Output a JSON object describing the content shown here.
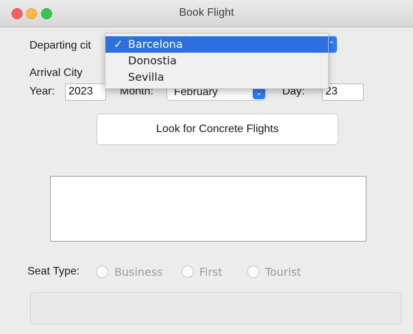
{
  "window": {
    "title": "Book Flight"
  },
  "form": {
    "departing_label": "Departing cit",
    "arrival_label": "Arrival City",
    "year_label": "Year:",
    "year_value": "2023",
    "month_label": "Month:",
    "month_value": "February",
    "day_label": "Day:",
    "day_value": "23",
    "search_button": "Look for Concrete Flights",
    "seat_type_label": "Seat Type:",
    "seat_options": [
      "Business",
      "First",
      "Tourist"
    ]
  },
  "dropdown": {
    "check": "✓",
    "options": [
      "Barcelona",
      "Donostia",
      "Sevilla"
    ],
    "selected_index": 0
  },
  "colors": {
    "accent": "#2b7cf6",
    "selected_row": "#2c6fde"
  }
}
